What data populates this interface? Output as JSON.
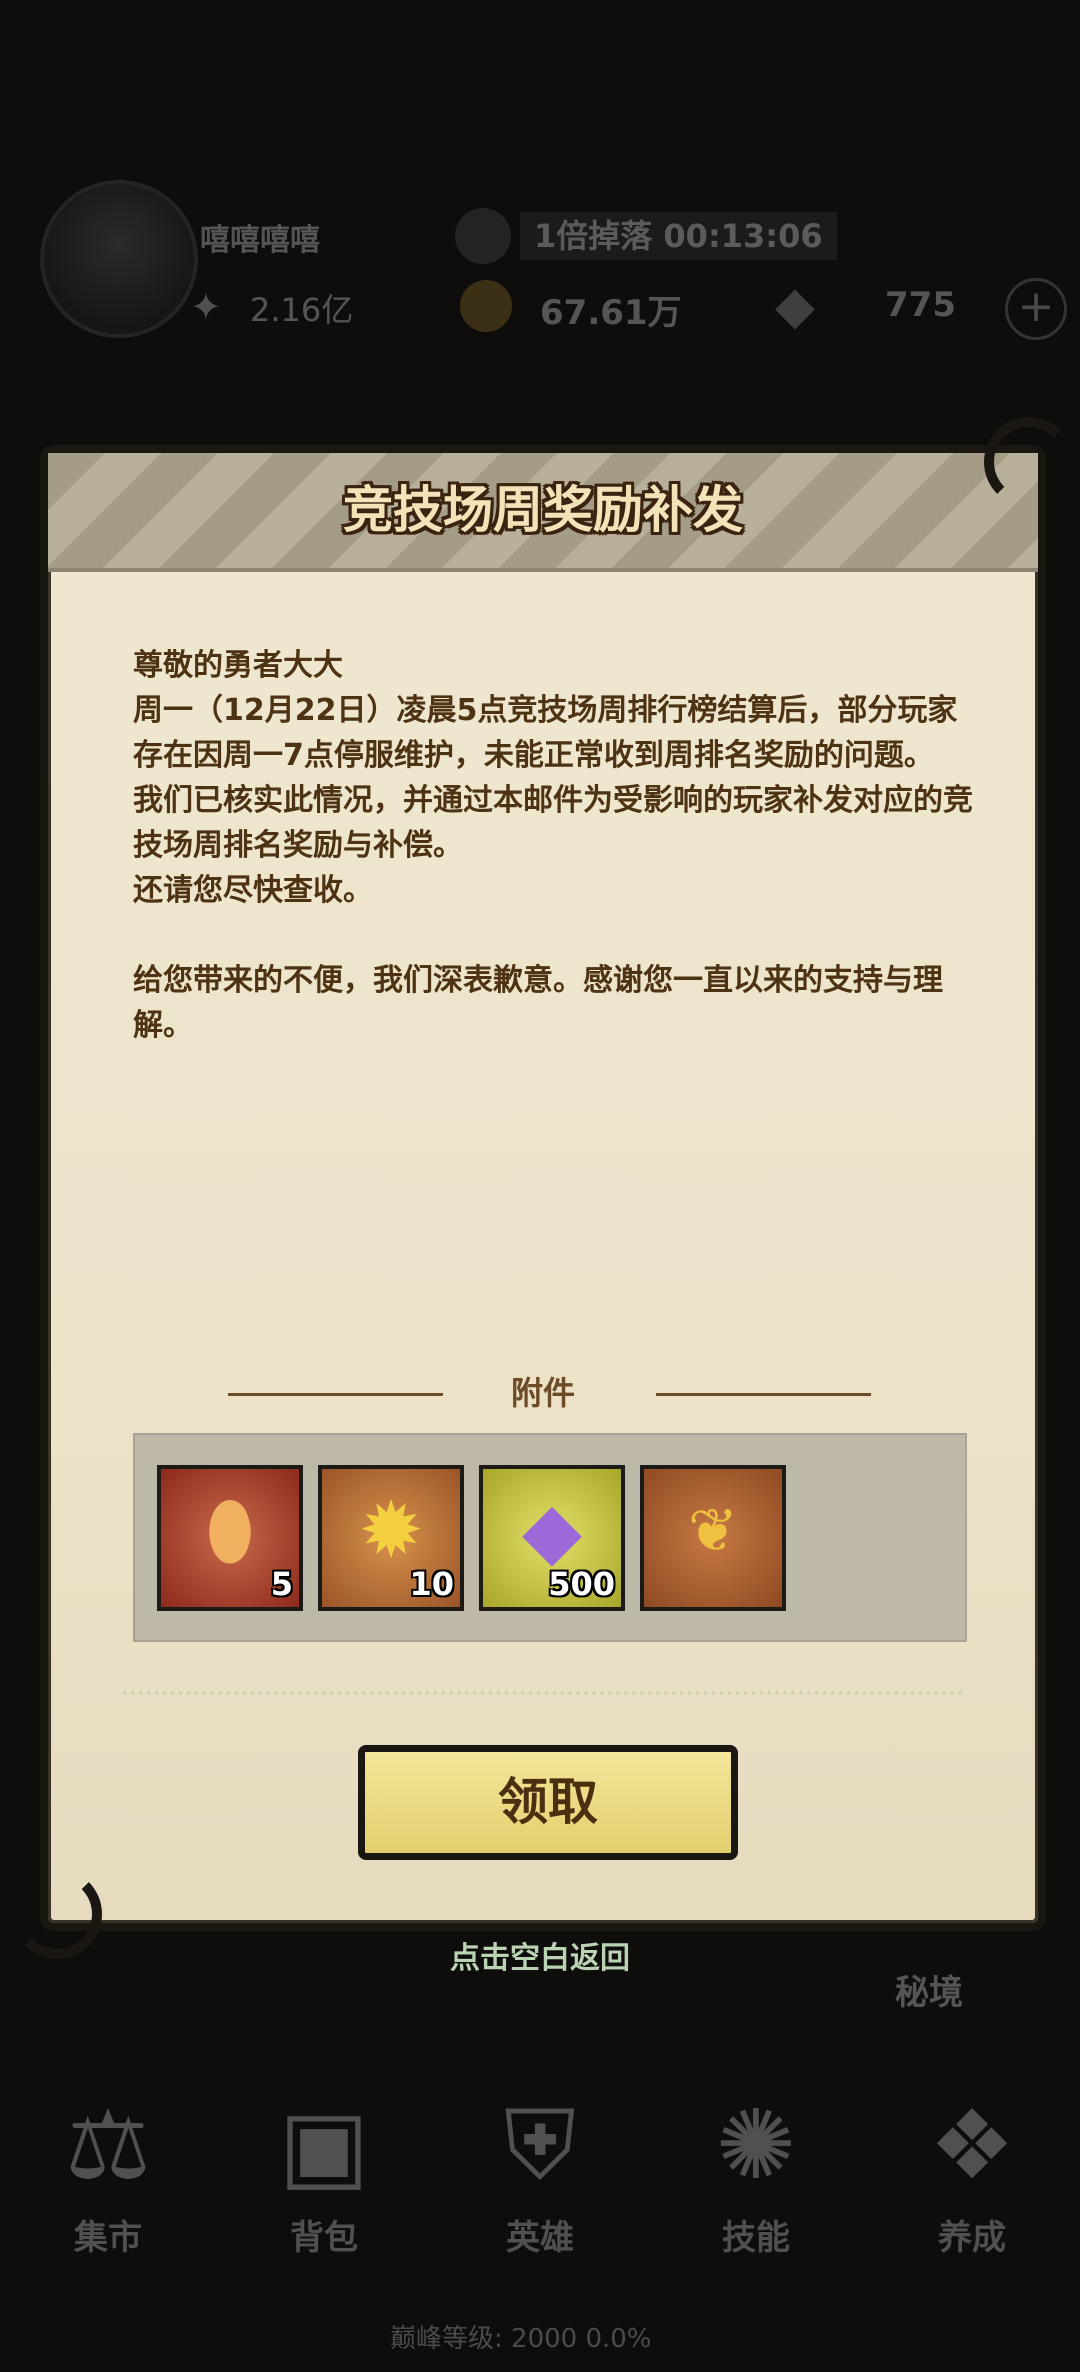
{
  "background": {
    "player_name": "嘻嘻嘻嘻",
    "power": "2.16亿",
    "buff_text": "1倍掉落 00:13:06",
    "gold": "67.61万",
    "gems": "775",
    "secret_realm": "秘境",
    "nav": [
      {
        "label": "集市",
        "icon": "scale-icon"
      },
      {
        "label": "背包",
        "icon": "bag-icon"
      },
      {
        "label": "英雄",
        "icon": "helmet-icon"
      },
      {
        "label": "技能",
        "icon": "flame-icon"
      },
      {
        "label": "养成",
        "icon": "grid-icon"
      }
    ],
    "bottom_status": "巅峰等级: 2000 0.0%"
  },
  "mail": {
    "title": "竞技场周奖励补发",
    "paragraphs": [
      "尊敬的勇者大大",
      "周一（12月22日）凌晨5点竞技场周排行榜结算后，部分玩家存在因周一7点停服维护，未能正常收到周排名奖励的问题。",
      "我们已核实此情况，并通过本邮件为受影响的玩家补发对应的竞技场周排名奖励与补偿。",
      "还请您尽快查收。",
      "给您带来的不便，我们深表歉意。感谢您一直以来的支持与理解。"
    ],
    "attachments_label": "附件",
    "attachments": [
      {
        "icon": "rune-stone-icon",
        "qty": "5"
      },
      {
        "icon": "gold-medal-icon",
        "qty": "10"
      },
      {
        "icon": "purple-gem-icon",
        "qty": "500"
      },
      {
        "icon": "arena-champion-badge-icon",
        "qty": ""
      }
    ],
    "claim_label": "领取"
  },
  "close_hint": "点击空白返回"
}
